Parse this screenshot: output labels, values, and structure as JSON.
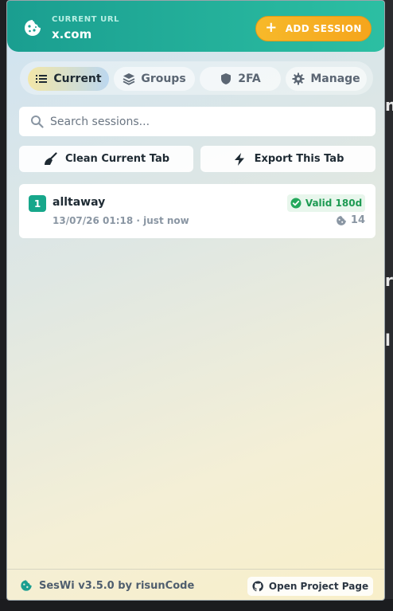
{
  "header": {
    "label": "CURRENT URL",
    "url": "x.com",
    "add_session_label": "ADD SESSION"
  },
  "tabs": [
    {
      "label": "Current",
      "icon": "list-icon",
      "active": true
    },
    {
      "label": "Groups",
      "icon": "layers-icon",
      "active": false
    },
    {
      "label": "2FA",
      "icon": "shield-icon",
      "active": false
    },
    {
      "label": "Manage",
      "icon": "gear-icon",
      "active": false
    }
  ],
  "search": {
    "placeholder": "Search sessions..."
  },
  "actions": {
    "clean_label": "Clean Current Tab",
    "export_label": "Export This Tab"
  },
  "sessions": [
    {
      "index": "1",
      "name": "alltaway",
      "meta": "13/07/26 01:18 · just now",
      "valid": "Valid 180d",
      "cookie_count": "14"
    }
  ],
  "footer": {
    "brand": "SesWi v3.5.0 by risunCode",
    "project_button": "Open Project Page"
  },
  "colors": {
    "header_teal": "#1a9e90",
    "accent_orange": "#f5a51c",
    "valid_green": "#1d9a52"
  }
}
